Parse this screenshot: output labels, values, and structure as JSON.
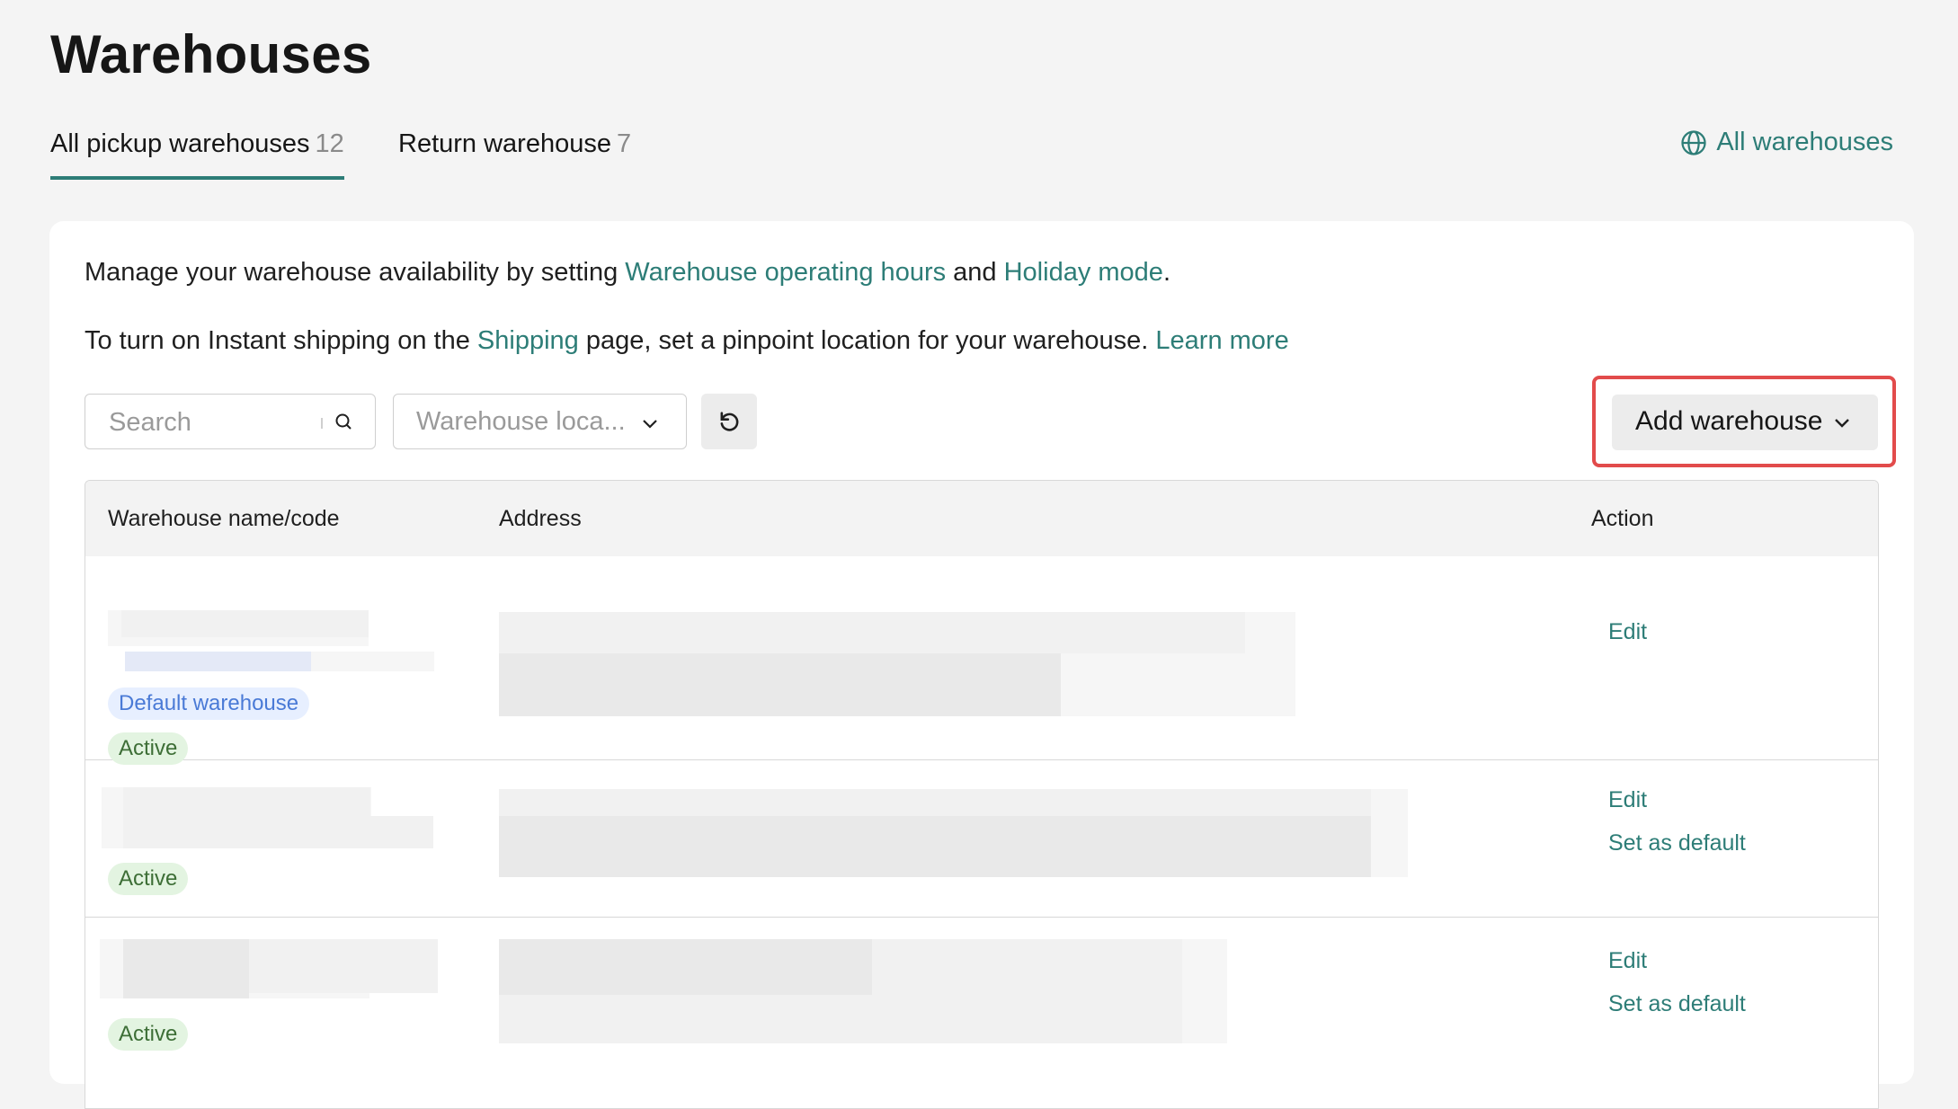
{
  "page": {
    "title": "Warehouses"
  },
  "tabs": [
    {
      "label": "All pickup warehouses",
      "count": "12"
    },
    {
      "label": "Return warehouse",
      "count": "7"
    }
  ],
  "all_warehouses_link": "All warehouses",
  "info": {
    "line1_prefix": "Manage your warehouse availability by setting ",
    "line1_link1": "Warehouse operating hours",
    "line1_mid": " and ",
    "line1_link2": "Holiday mode",
    "line1_suffix": ".",
    "line2_prefix": "To turn on Instant shipping on the ",
    "line2_link1": "Shipping",
    "line2_mid": " page, set a pinpoint location for your warehouse. ",
    "line2_link2": "Learn more"
  },
  "toolbar": {
    "search_placeholder": "Search",
    "location_select": "Warehouse loca...",
    "add_button": "Add warehouse"
  },
  "table": {
    "headers": {
      "name": "Warehouse name/code",
      "address": "Address",
      "action": "Action"
    },
    "rows": [
      {
        "badges": {
          "default": "Default warehouse",
          "status": "Active"
        },
        "actions": {
          "edit": "Edit"
        }
      },
      {
        "badges": {
          "status": "Active"
        },
        "actions": {
          "edit": "Edit",
          "set_default": "Set as default"
        }
      },
      {
        "badges": {
          "status": "Active"
        },
        "actions": {
          "edit": "Edit",
          "set_default": "Set as default"
        }
      }
    ]
  },
  "colors": {
    "accent": "#2d7d77",
    "highlight": "#e24b4b",
    "active_badge_bg": "#e3f4e1",
    "default_badge_bg": "#e7efff"
  }
}
